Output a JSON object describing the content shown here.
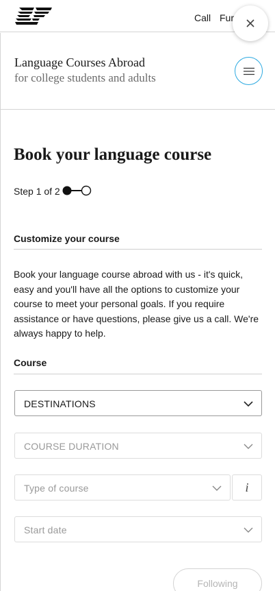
{
  "topbar": {
    "logo_text": "EF",
    "call_label": "Call",
    "fun_label": "Fur",
    "close_glyph": "×"
  },
  "header": {
    "title": "Language Courses Abroad",
    "subtitle": "for college students and adults"
  },
  "main": {
    "page_title": "Book your language course",
    "step_text": "Step 1 of 2",
    "customize_heading": "Customize your course",
    "intro_text": "Book your language course abroad with us - it's quick, easy and you'll have all the options to customize your course to meet your personal goals. If you require assistance or have questions, please give us a call. We're always happy to help.",
    "course_heading": "Course",
    "selects": {
      "destinations": "DESTINATIONS",
      "duration": "COURSE DURATION",
      "type": "Type of course",
      "start_date": "Start date"
    },
    "info_glyph": "i",
    "next_label": "Following"
  },
  "colors": {
    "accent_ring": "#2aa8e0",
    "text": "#191919",
    "muted": "#999999",
    "border": "#dcdcdc"
  },
  "icons": {
    "logo": "ef-logo",
    "close": "close-icon",
    "menu": "hamburger-icon",
    "chevron": "chevron-down-icon",
    "info": "info-icon"
  }
}
